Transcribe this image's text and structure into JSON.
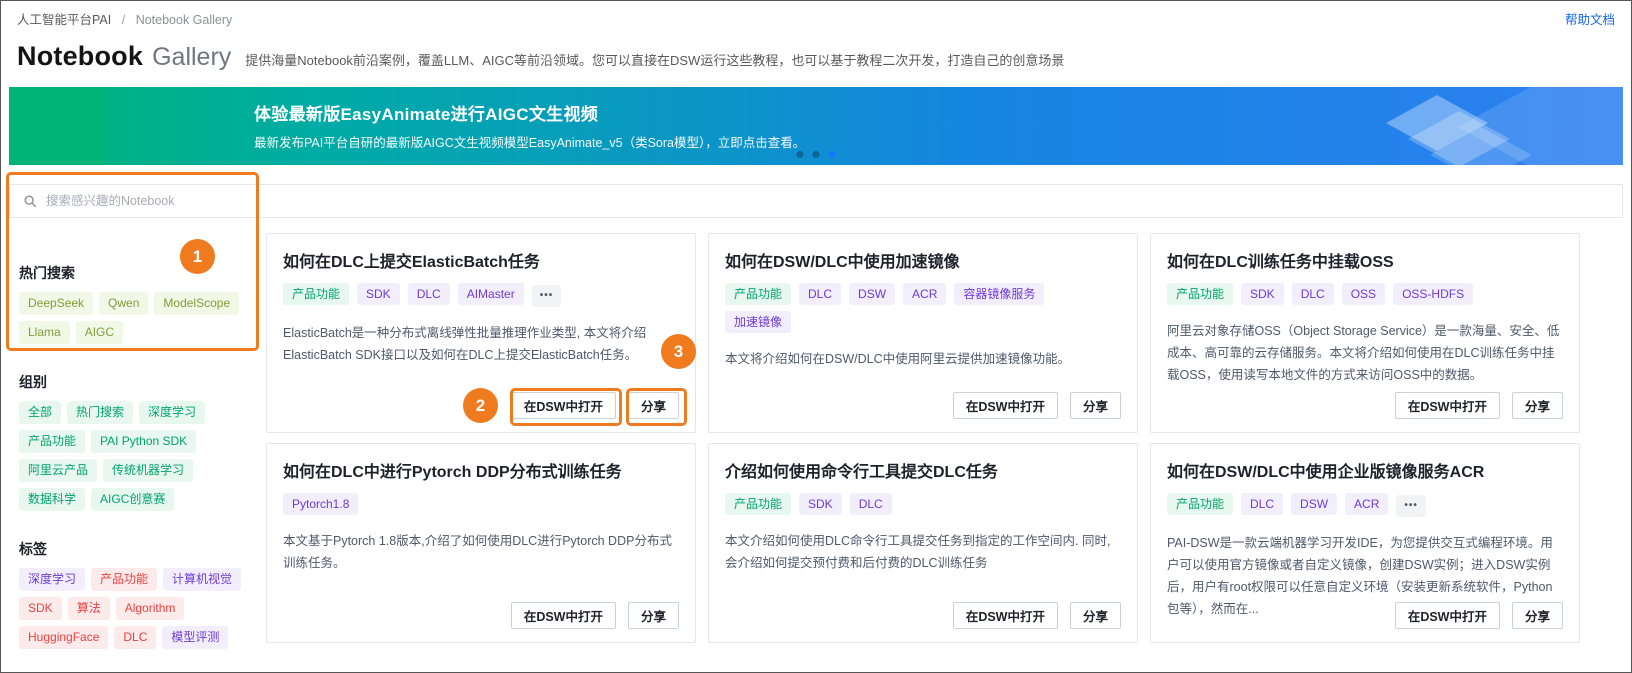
{
  "colors": {
    "annotation_orange": "#F07B1E",
    "link_blue": "#1366EC",
    "active_dot_blue": "#1677FF",
    "banner_green": "#00B478",
    "banner_teal": "#00ABA6",
    "banner_blue": "#2E80F2",
    "tag_green_text": "#00A46C",
    "tag_green_bg": "#E8F7F0",
    "tag_purple_text": "#6E3AD6",
    "tag_purple_bg": "#F3EEFB",
    "tag_red_text": "#E8423F",
    "tag_red_bg": "#FDEAEA",
    "tag_lime_text": "#7F9D3A",
    "tag_lime_bg": "#F2F8E6"
  },
  "topbar": {
    "breadcrumb": {
      "root": "人工智能平台PAI",
      "separator": "/",
      "current": "Notebook Gallery"
    },
    "help_link": "帮助文档"
  },
  "header": {
    "title_primary": "Notebook",
    "title_secondary": "Gallery",
    "subtitle": "提供海量Notebook前沿案例，覆盖LLM、AIGC等前沿领域。您可以直接在DSW运行这些教程，也可以基于教程二次开发，打造自己的创意场景"
  },
  "banner": {
    "title": "体验最新版EasyAnimate进行AIGC文生视频",
    "subtitle": "最新发布PAI平台自研的最新版AIGC文生视频模型EasyAnimate_v5（类Sora模型），立即点击查看。",
    "dots": [
      {
        "active": false
      },
      {
        "active": false
      },
      {
        "active": true
      }
    ]
  },
  "search": {
    "placeholder": "搜索感兴趣的Notebook"
  },
  "sidebar": {
    "sections": [
      {
        "title": "热门搜索",
        "tags": [
          {
            "label": "DeepSeek",
            "color": "lime"
          },
          {
            "label": "Qwen",
            "color": "lime"
          },
          {
            "label": "ModelScope",
            "color": "lime"
          },
          {
            "label": "Llama",
            "color": "lime"
          },
          {
            "label": "AIGC",
            "color": "lime"
          }
        ]
      },
      {
        "title": "组别",
        "tags": [
          {
            "label": "全部",
            "color": "green"
          },
          {
            "label": "热门搜索",
            "color": "green"
          },
          {
            "label": "深度学习",
            "color": "green"
          },
          {
            "label": "产品功能",
            "color": "green"
          },
          {
            "label": "PAI Python SDK",
            "color": "green"
          },
          {
            "label": "阿里云产品",
            "color": "green"
          },
          {
            "label": "传统机器学习",
            "color": "green"
          },
          {
            "label": "数据科学",
            "color": "green"
          },
          {
            "label": "AIGC创意赛",
            "color": "green"
          }
        ]
      },
      {
        "title": "标签",
        "tags": [
          {
            "label": "深度学习",
            "color": "purple"
          },
          {
            "label": "产品功能",
            "color": "red"
          },
          {
            "label": "计算机视觉",
            "color": "purple"
          },
          {
            "label": "SDK",
            "color": "red"
          },
          {
            "label": "算法",
            "color": "red"
          },
          {
            "label": "Algorithm",
            "color": "red"
          },
          {
            "label": "HuggingFace",
            "color": "red"
          },
          {
            "label": "DLC",
            "color": "red"
          },
          {
            "label": "模型评测",
            "color": "purple"
          }
        ]
      }
    ]
  },
  "card_actions": {
    "open": "在DSW中打开",
    "share": "分享",
    "more": "•••"
  },
  "cards": [
    {
      "title": "如何在DLC上提交ElasticBatch任务",
      "tags": [
        {
          "label": "产品功能",
          "color": "green"
        },
        {
          "label": "SDK",
          "color": "purple"
        },
        {
          "label": "DLC",
          "color": "purple"
        },
        {
          "label": "AIMaster",
          "color": "purple"
        }
      ],
      "has_more": true,
      "description": "ElasticBatch是一种分布式离线弹性批量推理作业类型, 本文将介绍ElasticBatch SDK接口以及如何在DLC上提交ElasticBatch任务。"
    },
    {
      "title": "如何在DSW/DLC中使用加速镜像",
      "tags": [
        {
          "label": "产品功能",
          "color": "green"
        },
        {
          "label": "DLC",
          "color": "purple"
        },
        {
          "label": "DSW",
          "color": "purple"
        },
        {
          "label": "ACR",
          "color": "purple"
        },
        {
          "label": "容器镜像服务",
          "color": "purple"
        },
        {
          "label": "加速镜像",
          "color": "purple"
        }
      ],
      "has_more": false,
      "description": "本文将介绍如何在DSW/DLC中使用阿里云提供加速镜像功能。"
    },
    {
      "title": "如何在DLC训练任务中挂载OSS",
      "tags": [
        {
          "label": "产品功能",
          "color": "green"
        },
        {
          "label": "SDK",
          "color": "purple"
        },
        {
          "label": "DLC",
          "color": "purple"
        },
        {
          "label": "OSS",
          "color": "purple"
        },
        {
          "label": "OSS-HDFS",
          "color": "purple"
        }
      ],
      "has_more": false,
      "description": "阿里云对象存储OSS（Object Storage Service）是一款海量、安全、低成本、高可靠的云存储服务。本文将介绍如何使用在DLC训练任务中挂载OSS，使用读写本地文件的方式来访问OSS中的数据。"
    },
    {
      "title": "如何在DLC中进行Pytorch DDP分布式训练任务",
      "tags": [
        {
          "label": "Pytorch1.8",
          "color": "purple"
        }
      ],
      "has_more": false,
      "description": "本文基于Pytorch 1.8版本,介绍了如何使用DLC进行Pytorch DDP分布式训练任务。"
    },
    {
      "title": "介绍如何使用命令行工具提交DLC任务",
      "tags": [
        {
          "label": "产品功能",
          "color": "green"
        },
        {
          "label": "SDK",
          "color": "purple"
        },
        {
          "label": "DLC",
          "color": "purple"
        }
      ],
      "has_more": false,
      "description": "本文介绍如何使用DLC命令行工具提交任务到指定的工作空间内. 同时,会介绍如何提交预付费和后付费的DLC训练任务"
    },
    {
      "title": "如何在DSW/DLC中使用企业版镜像服务ACR",
      "tags": [
        {
          "label": "产品功能",
          "color": "green"
        },
        {
          "label": "DLC",
          "color": "purple"
        },
        {
          "label": "DSW",
          "color": "purple"
        },
        {
          "label": "ACR",
          "color": "purple"
        }
      ],
      "has_more": true,
      "description": "PAI-DSW是一款云端机器学习开发IDE，为您提供交互式编程环境。用户可以使用官方镜像或者自定义镜像，创建DSW实例；进入DSW实例后，用户有root权限可以任意自定义环境（安装更新系统软件，Python包等），然而在..."
    }
  ],
  "annotations": {
    "labels": [
      "1",
      "2",
      "3"
    ]
  }
}
